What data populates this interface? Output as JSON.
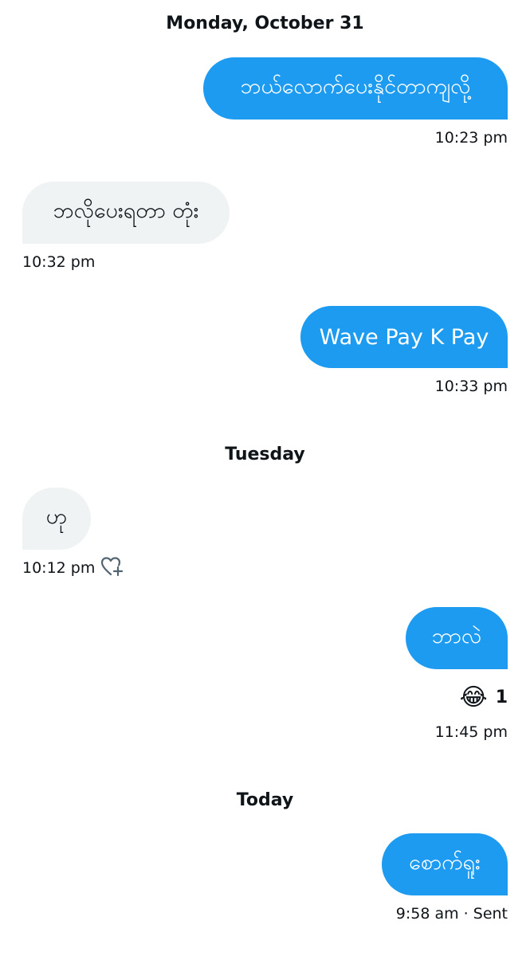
{
  "conversation": {
    "date_separators": {
      "first": "Monday, October 31",
      "second": "Tuesday",
      "third": "Today"
    },
    "messages": [
      {
        "direction": "outgoing",
        "text": "ဘယ်လောက်ပေးနိုင်တာကျလို့",
        "time": "10:23 pm"
      },
      {
        "direction": "incoming",
        "text": "ဘလိုပေးရတာ တုံး",
        "time": "10:32 pm"
      },
      {
        "direction": "outgoing",
        "text": "Wave Pay K Pay",
        "time": "10:33 pm"
      },
      {
        "direction": "incoming",
        "text": "ဟု",
        "time": "10:12 pm",
        "like_icon": "heart-plus-icon"
      },
      {
        "direction": "outgoing",
        "text": "ဘာလဲ",
        "time": "11:45 pm",
        "reaction": {
          "emoji": "😂",
          "count": "1"
        }
      },
      {
        "direction": "outgoing",
        "text": "စောက်ရူး",
        "time": "9:58 am · Sent"
      }
    ]
  },
  "colors": {
    "outgoing_bubble": "#1d9bf0",
    "incoming_bubble": "#eff3f4",
    "text": "#0f1419"
  }
}
